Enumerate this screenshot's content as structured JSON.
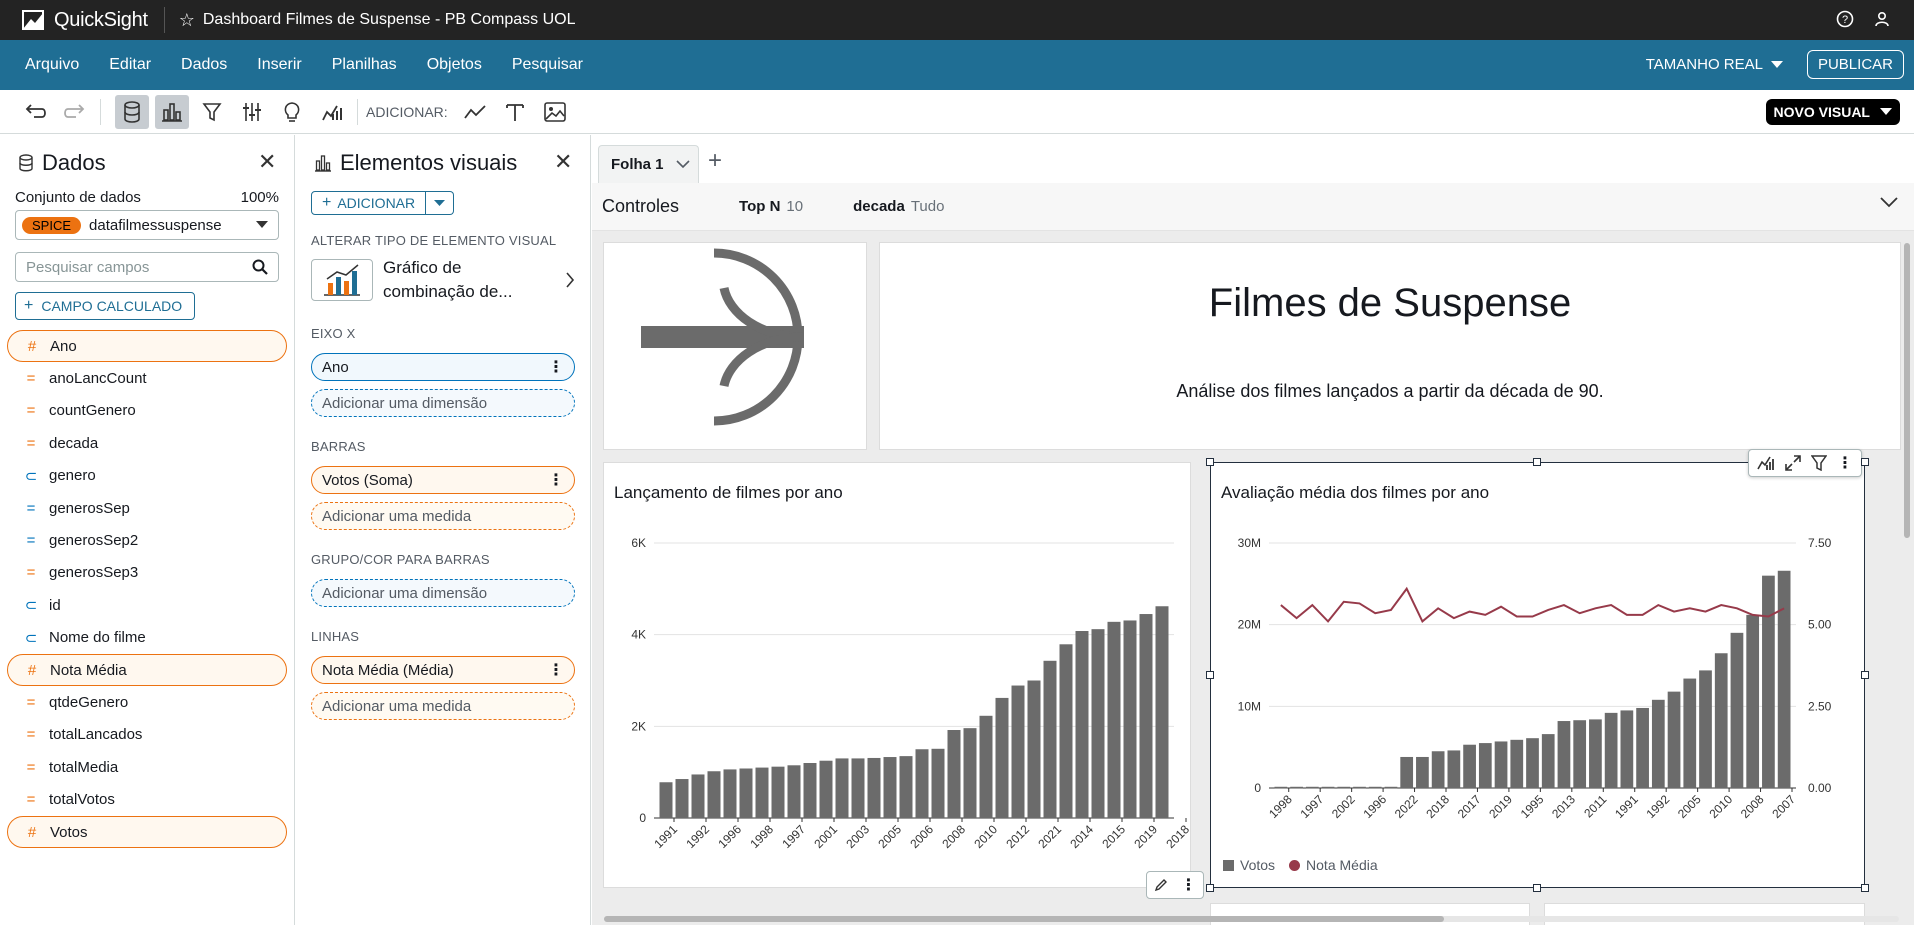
{
  "app": {
    "name": "QuickSight",
    "doc_title": "Dashboard Filmes de Suspense - PB Compass UOL"
  },
  "menu": {
    "items": [
      "Arquivo",
      "Editar",
      "Dados",
      "Inserir",
      "Planilhas",
      "Objetos",
      "Pesquisar"
    ],
    "size_label": "TAMANHO REAL",
    "publish_label": "PUBLICAR"
  },
  "toolbar": {
    "add_label": "ADICIONAR:",
    "new_visual_label": "NOVO VISUAL"
  },
  "data_panel": {
    "title": "Dados",
    "dataset_label": "Conjunto de dados",
    "dataset_percent": "100%",
    "spice_badge": "SPICE",
    "dataset_name": "datafilmessuspense",
    "search_placeholder": "Pesquisar campos",
    "calc_field_label": "CAMPO CALCULADO",
    "fields": [
      {
        "name": "Ano",
        "icon": "hash-icon",
        "selected": true
      },
      {
        "name": "anoLancCount",
        "icon": "measure-icon",
        "selected": false
      },
      {
        "name": "countGenero",
        "icon": "measure-icon",
        "selected": false
      },
      {
        "name": "decada",
        "icon": "measure-icon",
        "selected": false
      },
      {
        "name": "genero",
        "icon": "tag-icon",
        "selected": false
      },
      {
        "name": "generosSep",
        "icon": "dimension-icon",
        "selected": false
      },
      {
        "name": "generosSep2",
        "icon": "dimension-icon",
        "selected": false
      },
      {
        "name": "generosSep3",
        "icon": "measure-icon",
        "selected": false
      },
      {
        "name": "id",
        "icon": "tag-icon",
        "selected": false
      },
      {
        "name": "Nome do filme",
        "icon": "tag-icon",
        "selected": false
      },
      {
        "name": "Nota Média",
        "icon": "hash-icon",
        "selected": true
      },
      {
        "name": "qtdeGenero",
        "icon": "measure-icon",
        "selected": false
      },
      {
        "name": "totalLancados",
        "icon": "measure-icon",
        "selected": false
      },
      {
        "name": "totalMedia",
        "icon": "measure-icon",
        "selected": false
      },
      {
        "name": "totalVotos",
        "icon": "measure-icon",
        "selected": false
      },
      {
        "name": "Votos",
        "icon": "hash-icon",
        "selected": true
      }
    ]
  },
  "visuals_panel": {
    "title": "Elementos visuais",
    "add_label": "ADICIONAR",
    "change_type_label": "ALTERAR TIPO DE ELEMENTO VISUAL",
    "chart_type_name": "Gráfico de combinação de...",
    "x_axis_label": "EIXO X",
    "x_field": "Ano",
    "add_dimension": "Adicionar uma dimensão",
    "bars_label": "BARRAS",
    "bars_field": "Votos (Soma)",
    "add_measure": "Adicionar uma medida",
    "group_label": "GRUPO/COR PARA BARRAS",
    "lines_label": "LINHAS",
    "lines_field": "Nota Média (Média)"
  },
  "sheet": {
    "tab_name": "Folha 1",
    "controls_title": "Controles",
    "controls": [
      {
        "label": "Top N",
        "value": "10"
      },
      {
        "label": "decada",
        "value": "Tudo"
      }
    ]
  },
  "hero": {
    "title": "Filmes de Suspense",
    "subtitle": "Análise dos filmes lançados a partir da década de 90."
  },
  "colors": {
    "bar": "#6b6b6b",
    "line": "#973a4a",
    "menubar": "#1f6e94",
    "accent_orange": "#ec7211"
  },
  "chart_data": [
    {
      "type": "bar",
      "title": "Lançamento de filmes por ano",
      "categories": [
        "1991",
        "1992",
        "1996",
        "1998",
        "1997",
        "2001",
        "2003",
        "2005",
        "2006",
        "2008",
        "2010",
        "2012",
        "2021",
        "2014",
        "2015",
        "2019",
        "2018"
      ],
      "all_categories_count": 32,
      "values": [
        780,
        850,
        950,
        1020,
        1060,
        1080,
        1100,
        1120,
        1150,
        1200,
        1250,
        1300,
        1300,
        1310,
        1330,
        1350,
        1500,
        1510,
        1920,
        1960,
        2230,
        2620,
        2890,
        3000,
        3430,
        3790,
        4080,
        4120,
        4280,
        4310,
        4450,
        4620
      ],
      "y_ticks": [
        "0",
        "2K",
        "4K",
        "6K"
      ],
      "ylim": [
        0,
        6000
      ]
    },
    {
      "type": "bar+line",
      "title": "Avaliação média dos filmes por ano",
      "categories": [
        "1998",
        "1997",
        "2002",
        "1996",
        "2022",
        "2018",
        "2017",
        "2019",
        "1995",
        "2013",
        "2011",
        "1991",
        "1992",
        "2005",
        "2010",
        "2008",
        "2007"
      ],
      "all_categories_count": 34,
      "series": [
        {
          "name": "Votos",
          "type": "bar",
          "values": [
            150000,
            150000,
            150000,
            150000,
            150000,
            150000,
            150000,
            150000,
            3800000,
            3800000,
            4500000,
            4600000,
            5300000,
            5500000,
            5700000,
            5900000,
            6100000,
            6600000,
            8200000,
            8300000,
            8400000,
            9200000,
            9500000,
            9800000,
            10800000,
            11800000,
            13400000,
            14400000,
            16500000,
            19000000,
            21200000,
            26000000,
            26600000
          ]
        },
        {
          "name": "Nota Média",
          "type": "line",
          "axis": "right",
          "values": [
            5.6,
            5.2,
            5.6,
            5.1,
            5.7,
            5.65,
            5.35,
            5.45,
            6.1,
            5.1,
            5.5,
            5.2,
            5.4,
            5.3,
            5.55,
            5.25,
            5.25,
            5.45,
            5.6,
            5.35,
            5.5,
            5.6,
            5.3,
            5.3,
            5.6,
            5.4,
            5.5,
            5.4,
            5.6,
            5.5,
            5.3,
            5.25,
            5.5
          ]
        }
      ],
      "y_ticks": [
        "0",
        "10M",
        "20M",
        "30M"
      ],
      "y2_ticks": [
        "0.00",
        "2.50",
        "5.00",
        "7.50"
      ],
      "ylim": [
        0,
        30000000
      ],
      "y2lim": [
        0,
        7.5
      ],
      "legend": "bottom-left"
    }
  ]
}
